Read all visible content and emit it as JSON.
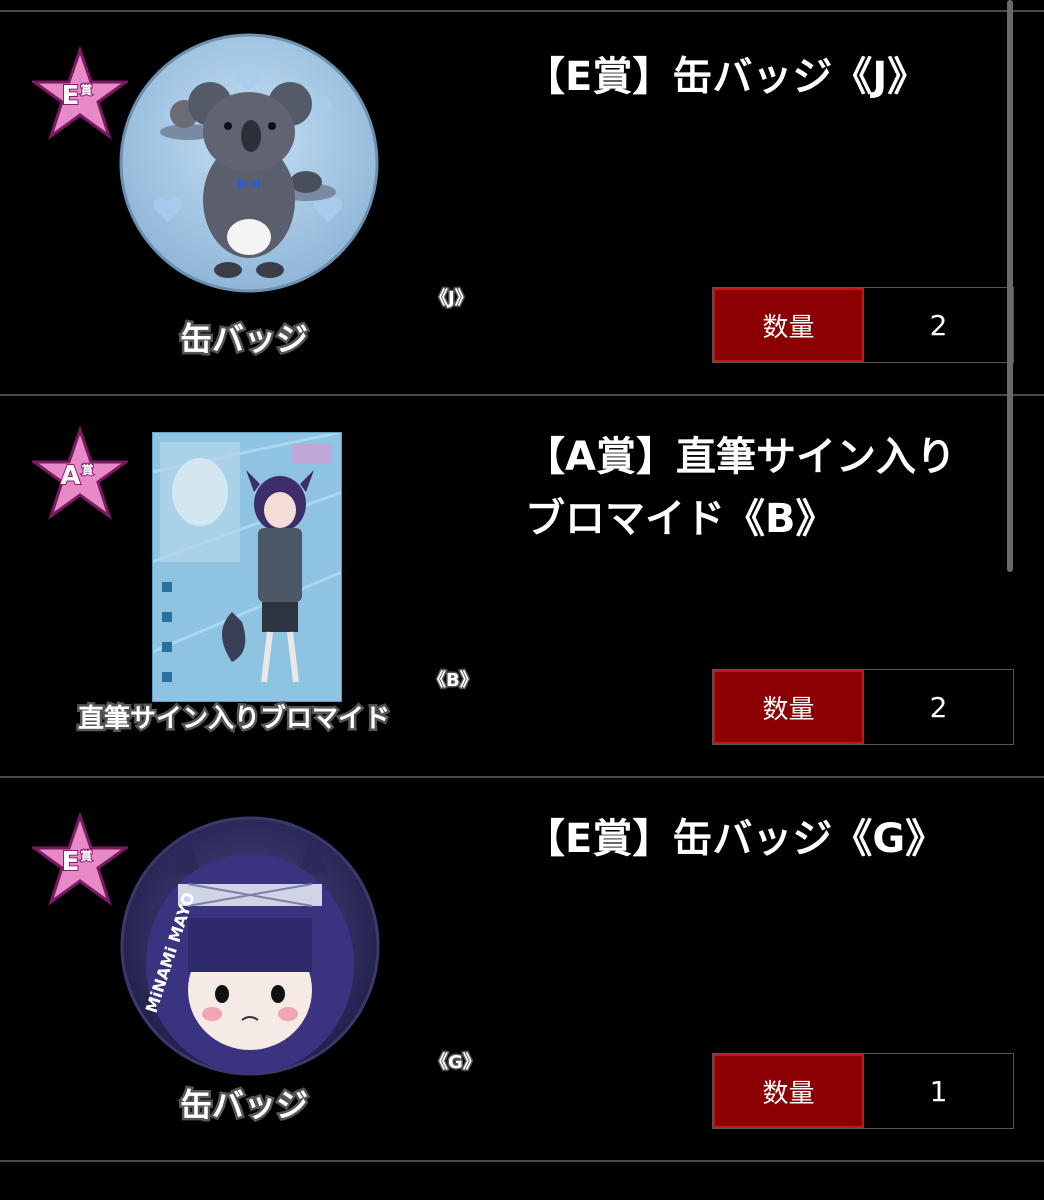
{
  "items": [
    {
      "rank_letter": "E",
      "rank_suffix": "賞",
      "title": "【E賞】缶バッジ《J》",
      "thumb_caption": "缶バッジ",
      "variant_mark": "《J》",
      "qty_label": "数量",
      "qty_value": "2",
      "thumb_type": "badge-koala"
    },
    {
      "rank_letter": "A",
      "rank_suffix": "賞",
      "title_line1": "【A賞】直筆サイン入り",
      "title_line2": "ブロマイド《B》",
      "thumb_caption": "直筆サイン入りブロマイド",
      "variant_mark": "《B》",
      "qty_label": "数量",
      "qty_value": "2",
      "thumb_type": "bromide-card"
    },
    {
      "rank_letter": "E",
      "rank_suffix": "賞",
      "title": "【E賞】缶バッジ《G》",
      "thumb_caption": "缶バッジ",
      "variant_mark": "《G》",
      "qty_label": "数量",
      "qty_value": "1",
      "thumb_type": "badge-girl",
      "badge_text": "MiNAMi MAYO"
    }
  ],
  "colors": {
    "background": "#000000",
    "qty_label_bg": "#8b0000",
    "star_pink": "#e889c8",
    "divider": "#4a4a4a"
  }
}
